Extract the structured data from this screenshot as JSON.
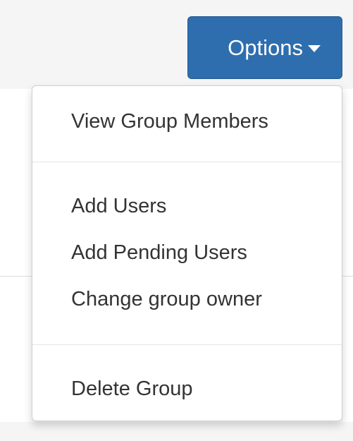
{
  "options_button": {
    "label": "Options"
  },
  "menu": {
    "view_group_members": "View Group Members",
    "add_users": "Add Users",
    "add_pending_users": "Add Pending Users",
    "change_group_owner": "Change group owner",
    "delete_group": "Delete Group"
  },
  "colors": {
    "button_bg": "#2e6eae",
    "menu_text": "#333333",
    "divider": "#e5e5e5"
  },
  "icons": {
    "button_caret": "caret-down-icon"
  }
}
